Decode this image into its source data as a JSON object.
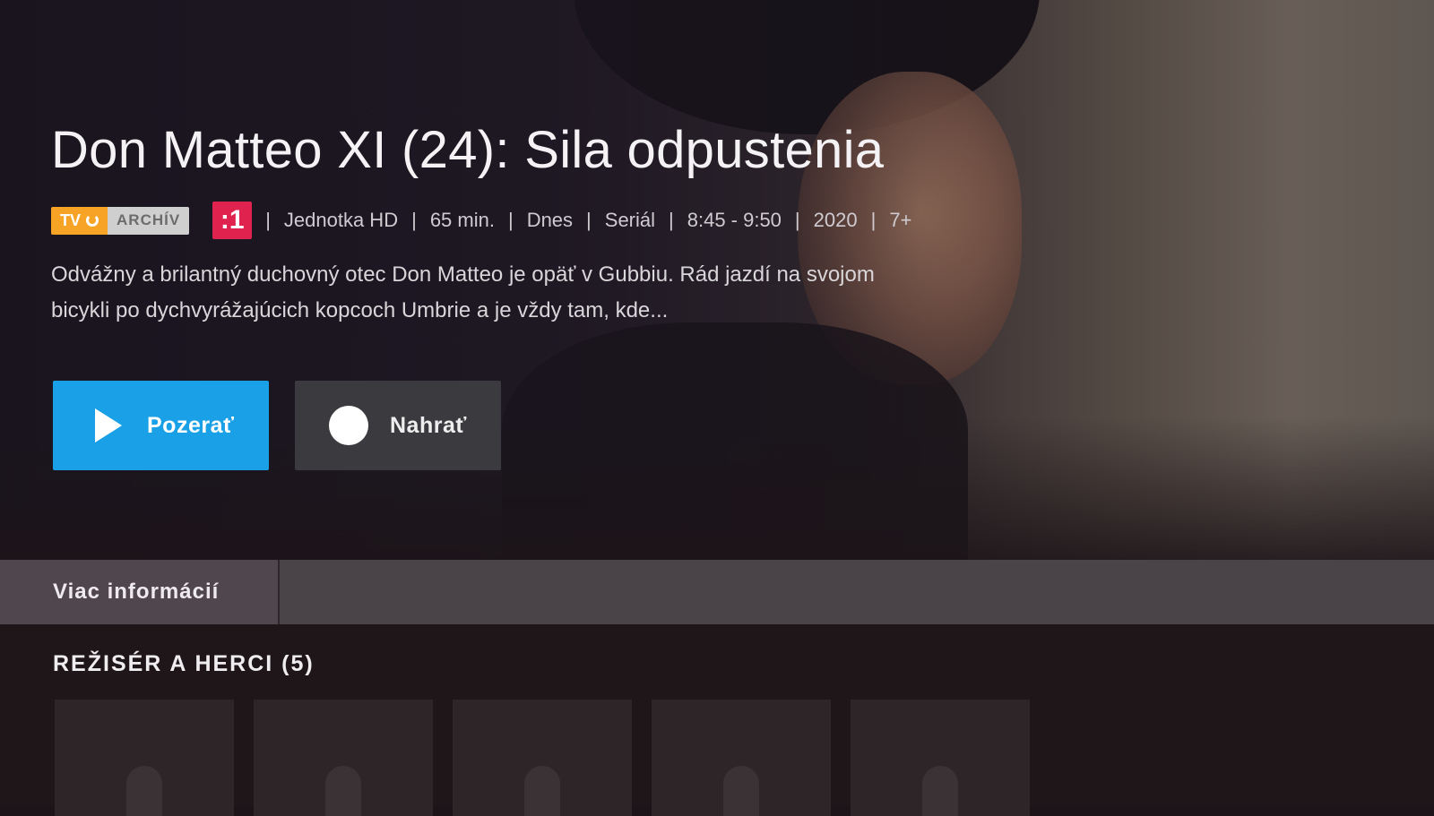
{
  "program": {
    "title": "Don Matteo XI (24): Sila odpustenia",
    "description": "Odvážny a brilantný duchovný otec Don Matteo je opäť v Gubbiu. Rád jazdí na svojom bicykli po dychvyrážajúcich kopcoch Umbrie a je vždy tam, kde..."
  },
  "badges": {
    "tv_label": "TV",
    "archive_label": "ARCHÍV",
    "channel_logo_text": ":1"
  },
  "meta": {
    "separator": "|",
    "channel": "Jednotka HD",
    "duration": "65 min.",
    "day": "Dnes",
    "genre": "Seriál",
    "time": "8:45 - 9:50",
    "year": "2020",
    "age_rating": "7+"
  },
  "actions": {
    "watch_label": "Pozerať",
    "record_label": "Nahrať"
  },
  "tabs": {
    "more_info_label": "Viac informácií"
  },
  "cast": {
    "heading": "REŽISÉR A HERCI (5)",
    "count": 5
  },
  "colors": {
    "watch_button": "#1aa0e6",
    "tv_badge": "#f7a325",
    "channel_logo": "#e0224e"
  },
  "icons": {
    "play": "play-icon",
    "record": "record-icon",
    "archive": "tv-archive-icon",
    "person": "person-placeholder-icon"
  }
}
